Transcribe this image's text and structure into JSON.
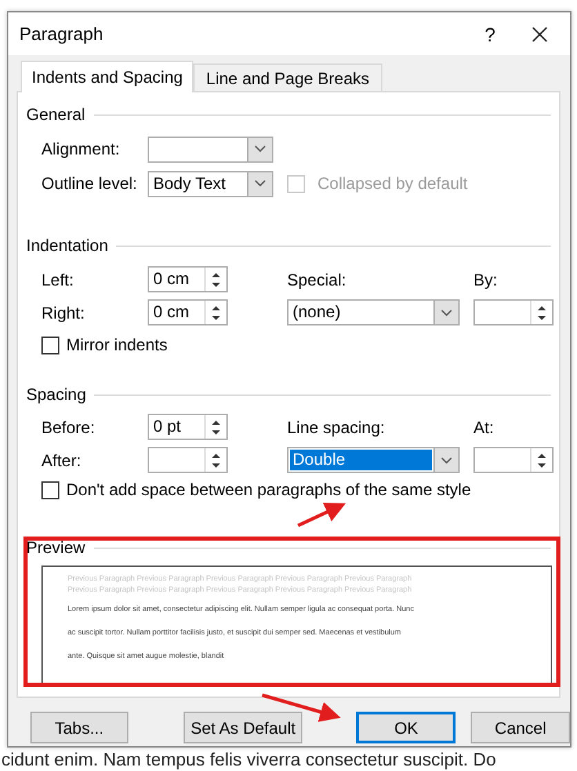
{
  "window": {
    "title": "Paragraph",
    "help": "?"
  },
  "tabs": [
    {
      "label": "Indents and Spacing",
      "selected": true
    },
    {
      "label": "Line and Page Breaks",
      "selected": false
    }
  ],
  "general": {
    "heading": "General",
    "alignment": {
      "label": "Alignment:"
    },
    "outline_level": {
      "label": "Outline level:",
      "value": "Body Text"
    },
    "collapsed": {
      "label": "Collapsed by default",
      "checked": false,
      "disabled": true
    }
  },
  "indentation": {
    "heading": "Indentation",
    "left": {
      "label": "Left:",
      "value": "0 cm"
    },
    "right": {
      "label": "Right:",
      "value": "0 cm"
    },
    "special": {
      "label": "Special:",
      "value": "(none)"
    },
    "by": {
      "label": "By:"
    },
    "mirror": {
      "label": "Mirror indents",
      "checked": false
    }
  },
  "spacing": {
    "heading": "Spacing",
    "before": {
      "label": "Before:",
      "value": "0 pt"
    },
    "after": {
      "label": "After:"
    },
    "line_spacing": {
      "label": "Line spacing:",
      "value": "Double",
      "selected": true
    },
    "at": {
      "label": "At:"
    },
    "dont_add": {
      "label": "Don't add space between paragraphs of the same style",
      "checked": false
    }
  },
  "preview": {
    "heading": "Preview",
    "previous": [
      "Previous Paragraph Previous Paragraph Previous Paragraph Previous Paragraph Previous Paragraph",
      "Previous Paragraph Previous Paragraph Previous Paragraph Previous Paragraph Previous Paragraph"
    ],
    "sample": [
      "Lorem ipsum dolor sit amet, consectetur adipiscing elit. Nullam semper ligula ac consequat porta. Nunc",
      "ac suscipit tortor. Nullam porttitor facilisis justo, et suscipit dui semper sed. Maecenas et vestibulum",
      "ante. Quisque sit amet augue molestie, blandit"
    ]
  },
  "buttons": [
    {
      "label": "Tabs...",
      "default": false
    },
    {
      "label": "Set As Default",
      "default": false
    },
    {
      "label": "OK",
      "default": true
    },
    {
      "label": "Cancel",
      "default": false
    }
  ],
  "document_text": "cidunt enim. Nam tempus felis viverra consectetur suscipit. Do"
}
